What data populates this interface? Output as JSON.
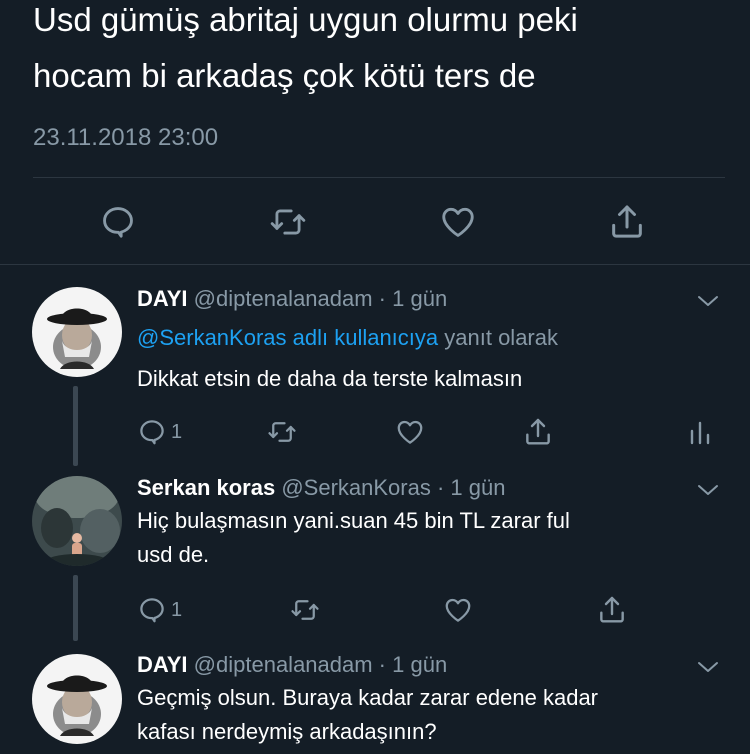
{
  "main_tweet": {
    "text_line1": "Usd gümüş abritaj uygun olurmu peki",
    "text_line2": "hocam bi arkadaş çok kötü ters de",
    "timestamp": "23.11.2018 23:00",
    "actions": [
      "reply-icon",
      "retweet-icon",
      "like-icon",
      "share-icon"
    ]
  },
  "replies": [
    {
      "name": "DAYI",
      "handle": "@diptenalanadam · 1 gün",
      "replying_to_link": "@SerkanKoras adlı kullanıcıya",
      "replying_to_suffix": " yanıt olarak",
      "text": "Dikkat etsin de daha da terste kalmasın",
      "reply_count": "1",
      "has_analytics": true
    },
    {
      "name": "Serkan koras",
      "handle": "@SerkanKoras · 1 gün",
      "text_line1": "Hiç bulaşmasın yani.suan 45 bin TL zarar ful",
      "text_line2": "usd de.",
      "reply_count": "1"
    },
    {
      "name": "DAYI",
      "handle": "@diptenalanadam · 1 gün",
      "text_line1": "Geçmiş olsun. Buraya kadar zarar edene kadar",
      "text_line2": "kafası nerdeymiş arkadaşının?"
    }
  ],
  "colors": {
    "background": "#141d26",
    "text": "#ffffff",
    "muted": "#8899a6",
    "link": "#1da1f2",
    "divider": "#2c3640"
  }
}
